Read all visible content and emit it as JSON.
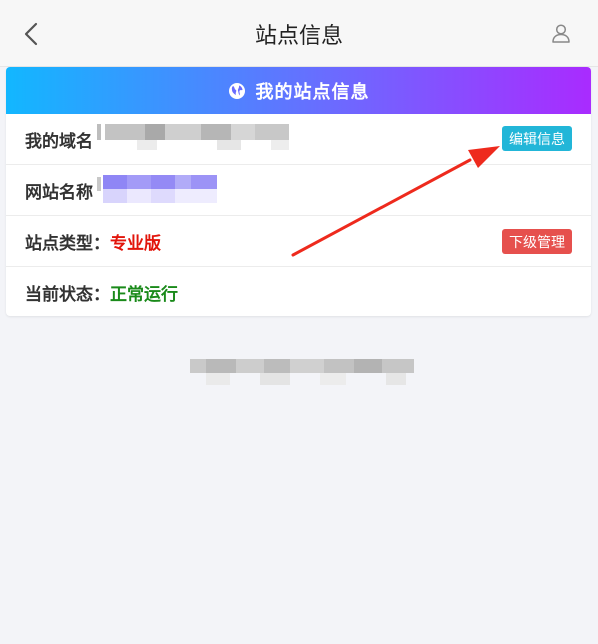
{
  "header": {
    "title": "站点信息",
    "back_icon": "chevron-left-icon",
    "user_icon": "user-icon"
  },
  "card": {
    "title": "我的站点信息",
    "title_icon": "globe-icon",
    "rows": [
      {
        "label": "我的域名",
        "value": "",
        "button": "编辑信息"
      },
      {
        "label": "网站名称",
        "value": ""
      },
      {
        "label": "站点类型：",
        "value": "专业版",
        "button": "下级管理"
      },
      {
        "label": "当前状态：",
        "value": "正常运行"
      }
    ]
  },
  "colors": {
    "header_gradient_start": "#12b7ff",
    "header_gradient_end": "#a92bff",
    "edit_button": "#22b6d8",
    "sub_button": "#e6504d",
    "type_value": "#e2150b",
    "status_value": "#1a8a1a",
    "annotation_arrow": "#ee2a1d"
  }
}
